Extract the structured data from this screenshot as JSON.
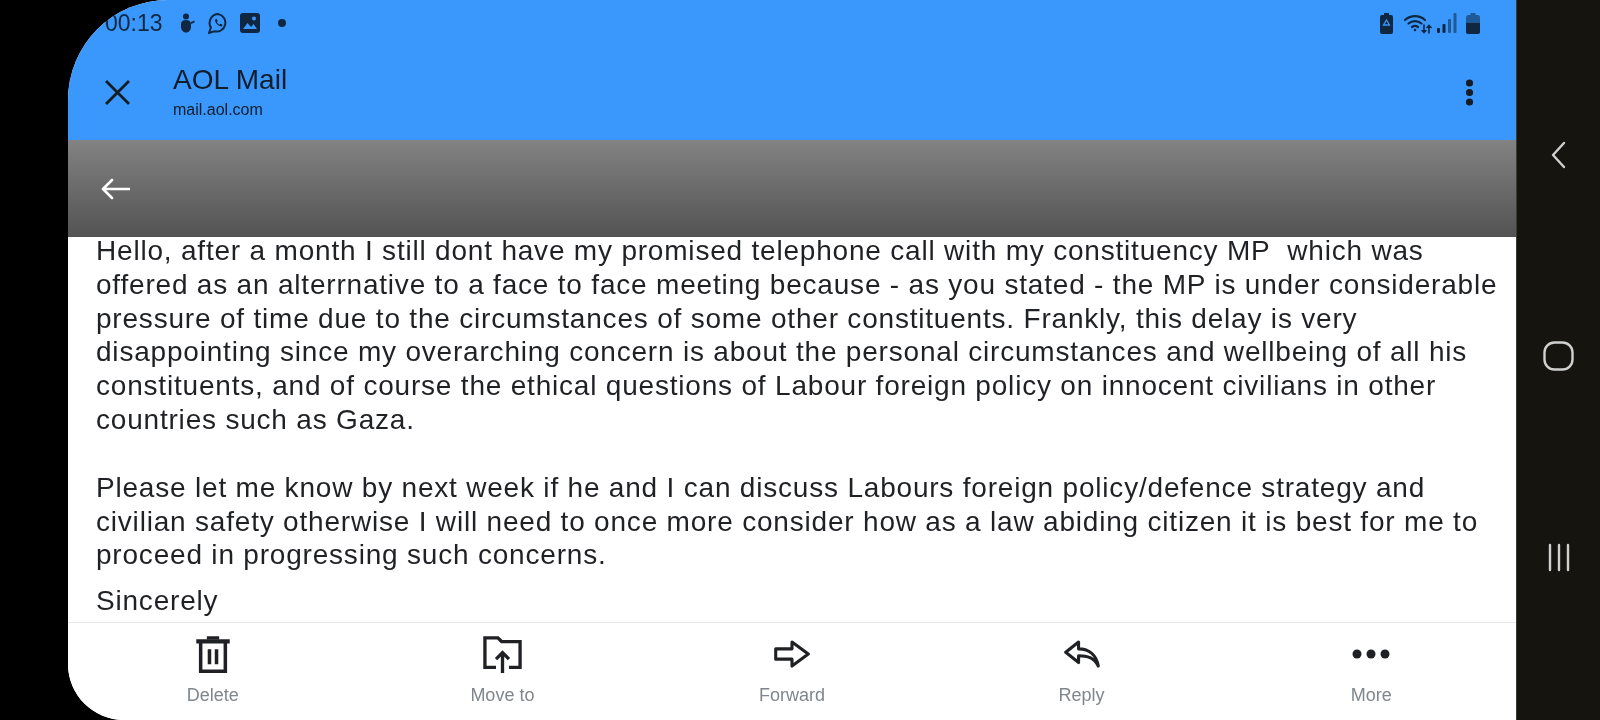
{
  "status_bar": {
    "time": "00:13"
  },
  "header": {
    "title": "AOL Mail",
    "url": "mail.aol.com"
  },
  "message": {
    "paragraphs": [
      "Hello, after a month I still dont have my promised telephone call with my constituency MP  which was offered as an alterrnative to a face to face meeting because - as you stated - the MP is under considerable pressure of time due to the circumstances of some other constituents. Frankly, this delay is very disappointing since my overarching concern is about the personal circumstances and wellbeing of all his constituents, and of course the ethical questions of Labour foreign policy on innocent civilians in other countries such as Gaza.",
      "Please let me know by next week if he and I can discuss Labours foreign policy/defence strategy and civilian safety otherwise I will need to once more consider how as a law abiding citizen it is best for me to proceed in progressing such concerns.",
      "Sincerely"
    ]
  },
  "toolbar": {
    "items": [
      {
        "kind": "delete",
        "label": "Delete"
      },
      {
        "kind": "move",
        "label": "Move to"
      },
      {
        "kind": "forward",
        "label": "Forward"
      },
      {
        "kind": "reply",
        "label": "Reply"
      },
      {
        "kind": "more",
        "label": "More"
      }
    ]
  }
}
